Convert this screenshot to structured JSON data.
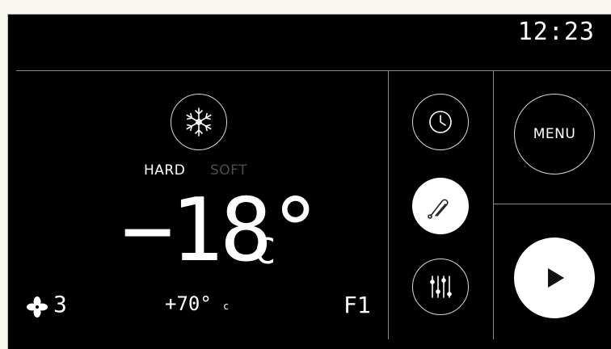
{
  "status_bar": {
    "time": "12:23"
  },
  "mode": {
    "icon": "snowflake-icon",
    "hard_label": "HARD",
    "soft_label": "SOFT",
    "active": "HARD"
  },
  "temperature": {
    "value": "−18°",
    "unit": "C"
  },
  "fan": {
    "icon": "fan-icon",
    "speed": "3"
  },
  "probe_temp": {
    "value": "+70°",
    "unit": "c"
  },
  "program": {
    "label": "F1"
  },
  "side_buttons": {
    "timer_icon": "clock-icon",
    "probe_icon": "probe-icon",
    "settings_icon": "sliders-icon"
  },
  "right_panel": {
    "menu_label": "MENU",
    "start_icon": "play-icon"
  },
  "colors": {
    "background": "#000000",
    "foreground": "#ffffff",
    "inactive": "#555555",
    "divider": "#8a8a8a"
  }
}
